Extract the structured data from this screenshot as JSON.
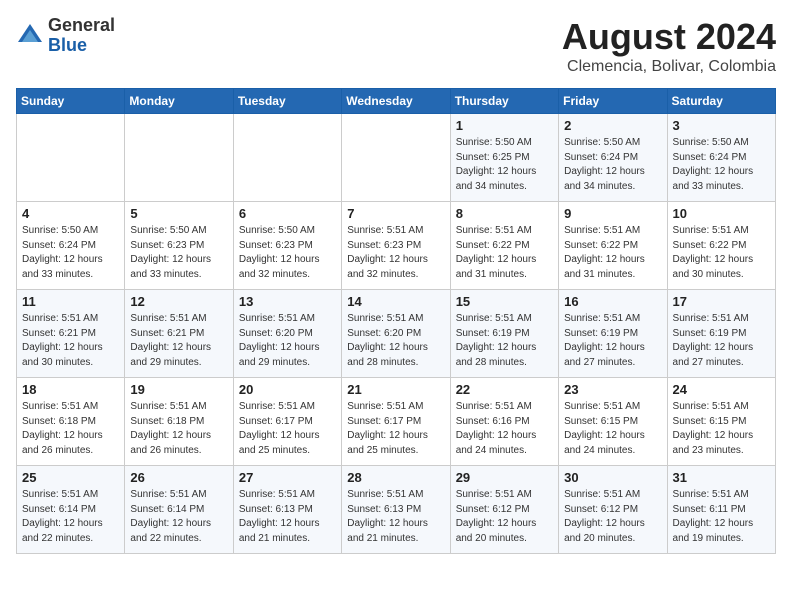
{
  "header": {
    "logo_general": "General",
    "logo_blue": "Blue",
    "month_year": "August 2024",
    "location": "Clemencia, Bolivar, Colombia"
  },
  "days_of_week": [
    "Sunday",
    "Monday",
    "Tuesday",
    "Wednesday",
    "Thursday",
    "Friday",
    "Saturday"
  ],
  "weeks": [
    [
      {
        "day": "",
        "info": ""
      },
      {
        "day": "",
        "info": ""
      },
      {
        "day": "",
        "info": ""
      },
      {
        "day": "",
        "info": ""
      },
      {
        "day": "1",
        "info": "Sunrise: 5:50 AM\nSunset: 6:25 PM\nDaylight: 12 hours\nand 34 minutes."
      },
      {
        "day": "2",
        "info": "Sunrise: 5:50 AM\nSunset: 6:24 PM\nDaylight: 12 hours\nand 34 minutes."
      },
      {
        "day": "3",
        "info": "Sunrise: 5:50 AM\nSunset: 6:24 PM\nDaylight: 12 hours\nand 33 minutes."
      }
    ],
    [
      {
        "day": "4",
        "info": "Sunrise: 5:50 AM\nSunset: 6:24 PM\nDaylight: 12 hours\nand 33 minutes."
      },
      {
        "day": "5",
        "info": "Sunrise: 5:50 AM\nSunset: 6:23 PM\nDaylight: 12 hours\nand 33 minutes."
      },
      {
        "day": "6",
        "info": "Sunrise: 5:50 AM\nSunset: 6:23 PM\nDaylight: 12 hours\nand 32 minutes."
      },
      {
        "day": "7",
        "info": "Sunrise: 5:51 AM\nSunset: 6:23 PM\nDaylight: 12 hours\nand 32 minutes."
      },
      {
        "day": "8",
        "info": "Sunrise: 5:51 AM\nSunset: 6:22 PM\nDaylight: 12 hours\nand 31 minutes."
      },
      {
        "day": "9",
        "info": "Sunrise: 5:51 AM\nSunset: 6:22 PM\nDaylight: 12 hours\nand 31 minutes."
      },
      {
        "day": "10",
        "info": "Sunrise: 5:51 AM\nSunset: 6:22 PM\nDaylight: 12 hours\nand 30 minutes."
      }
    ],
    [
      {
        "day": "11",
        "info": "Sunrise: 5:51 AM\nSunset: 6:21 PM\nDaylight: 12 hours\nand 30 minutes."
      },
      {
        "day": "12",
        "info": "Sunrise: 5:51 AM\nSunset: 6:21 PM\nDaylight: 12 hours\nand 29 minutes."
      },
      {
        "day": "13",
        "info": "Sunrise: 5:51 AM\nSunset: 6:20 PM\nDaylight: 12 hours\nand 29 minutes."
      },
      {
        "day": "14",
        "info": "Sunrise: 5:51 AM\nSunset: 6:20 PM\nDaylight: 12 hours\nand 28 minutes."
      },
      {
        "day": "15",
        "info": "Sunrise: 5:51 AM\nSunset: 6:19 PM\nDaylight: 12 hours\nand 28 minutes."
      },
      {
        "day": "16",
        "info": "Sunrise: 5:51 AM\nSunset: 6:19 PM\nDaylight: 12 hours\nand 27 minutes."
      },
      {
        "day": "17",
        "info": "Sunrise: 5:51 AM\nSunset: 6:19 PM\nDaylight: 12 hours\nand 27 minutes."
      }
    ],
    [
      {
        "day": "18",
        "info": "Sunrise: 5:51 AM\nSunset: 6:18 PM\nDaylight: 12 hours\nand 26 minutes."
      },
      {
        "day": "19",
        "info": "Sunrise: 5:51 AM\nSunset: 6:18 PM\nDaylight: 12 hours\nand 26 minutes."
      },
      {
        "day": "20",
        "info": "Sunrise: 5:51 AM\nSunset: 6:17 PM\nDaylight: 12 hours\nand 25 minutes."
      },
      {
        "day": "21",
        "info": "Sunrise: 5:51 AM\nSunset: 6:17 PM\nDaylight: 12 hours\nand 25 minutes."
      },
      {
        "day": "22",
        "info": "Sunrise: 5:51 AM\nSunset: 6:16 PM\nDaylight: 12 hours\nand 24 minutes."
      },
      {
        "day": "23",
        "info": "Sunrise: 5:51 AM\nSunset: 6:15 PM\nDaylight: 12 hours\nand 24 minutes."
      },
      {
        "day": "24",
        "info": "Sunrise: 5:51 AM\nSunset: 6:15 PM\nDaylight: 12 hours\nand 23 minutes."
      }
    ],
    [
      {
        "day": "25",
        "info": "Sunrise: 5:51 AM\nSunset: 6:14 PM\nDaylight: 12 hours\nand 22 minutes."
      },
      {
        "day": "26",
        "info": "Sunrise: 5:51 AM\nSunset: 6:14 PM\nDaylight: 12 hours\nand 22 minutes."
      },
      {
        "day": "27",
        "info": "Sunrise: 5:51 AM\nSunset: 6:13 PM\nDaylight: 12 hours\nand 21 minutes."
      },
      {
        "day": "28",
        "info": "Sunrise: 5:51 AM\nSunset: 6:13 PM\nDaylight: 12 hours\nand 21 minutes."
      },
      {
        "day": "29",
        "info": "Sunrise: 5:51 AM\nSunset: 6:12 PM\nDaylight: 12 hours\nand 20 minutes."
      },
      {
        "day": "30",
        "info": "Sunrise: 5:51 AM\nSunset: 6:12 PM\nDaylight: 12 hours\nand 20 minutes."
      },
      {
        "day": "31",
        "info": "Sunrise: 5:51 AM\nSunset: 6:11 PM\nDaylight: 12 hours\nand 19 minutes."
      }
    ]
  ]
}
